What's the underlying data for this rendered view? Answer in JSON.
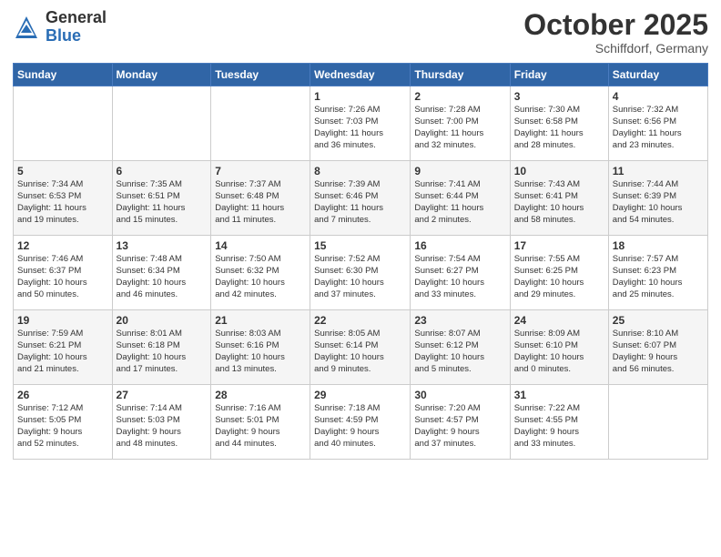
{
  "header": {
    "logo_general": "General",
    "logo_blue": "Blue",
    "month": "October 2025",
    "location": "Schiffdorf, Germany"
  },
  "days_of_week": [
    "Sunday",
    "Monday",
    "Tuesday",
    "Wednesday",
    "Thursday",
    "Friday",
    "Saturday"
  ],
  "weeks": [
    [
      {
        "day": "",
        "info": ""
      },
      {
        "day": "",
        "info": ""
      },
      {
        "day": "",
        "info": ""
      },
      {
        "day": "1",
        "info": "Sunrise: 7:26 AM\nSunset: 7:03 PM\nDaylight: 11 hours\nand 36 minutes."
      },
      {
        "day": "2",
        "info": "Sunrise: 7:28 AM\nSunset: 7:00 PM\nDaylight: 11 hours\nand 32 minutes."
      },
      {
        "day": "3",
        "info": "Sunrise: 7:30 AM\nSunset: 6:58 PM\nDaylight: 11 hours\nand 28 minutes."
      },
      {
        "day": "4",
        "info": "Sunrise: 7:32 AM\nSunset: 6:56 PM\nDaylight: 11 hours\nand 23 minutes."
      }
    ],
    [
      {
        "day": "5",
        "info": "Sunrise: 7:34 AM\nSunset: 6:53 PM\nDaylight: 11 hours\nand 19 minutes."
      },
      {
        "day": "6",
        "info": "Sunrise: 7:35 AM\nSunset: 6:51 PM\nDaylight: 11 hours\nand 15 minutes."
      },
      {
        "day": "7",
        "info": "Sunrise: 7:37 AM\nSunset: 6:48 PM\nDaylight: 11 hours\nand 11 minutes."
      },
      {
        "day": "8",
        "info": "Sunrise: 7:39 AM\nSunset: 6:46 PM\nDaylight: 11 hours\nand 7 minutes."
      },
      {
        "day": "9",
        "info": "Sunrise: 7:41 AM\nSunset: 6:44 PM\nDaylight: 11 hours\nand 2 minutes."
      },
      {
        "day": "10",
        "info": "Sunrise: 7:43 AM\nSunset: 6:41 PM\nDaylight: 10 hours\nand 58 minutes."
      },
      {
        "day": "11",
        "info": "Sunrise: 7:44 AM\nSunset: 6:39 PM\nDaylight: 10 hours\nand 54 minutes."
      }
    ],
    [
      {
        "day": "12",
        "info": "Sunrise: 7:46 AM\nSunset: 6:37 PM\nDaylight: 10 hours\nand 50 minutes."
      },
      {
        "day": "13",
        "info": "Sunrise: 7:48 AM\nSunset: 6:34 PM\nDaylight: 10 hours\nand 46 minutes."
      },
      {
        "day": "14",
        "info": "Sunrise: 7:50 AM\nSunset: 6:32 PM\nDaylight: 10 hours\nand 42 minutes."
      },
      {
        "day": "15",
        "info": "Sunrise: 7:52 AM\nSunset: 6:30 PM\nDaylight: 10 hours\nand 37 minutes."
      },
      {
        "day": "16",
        "info": "Sunrise: 7:54 AM\nSunset: 6:27 PM\nDaylight: 10 hours\nand 33 minutes."
      },
      {
        "day": "17",
        "info": "Sunrise: 7:55 AM\nSunset: 6:25 PM\nDaylight: 10 hours\nand 29 minutes."
      },
      {
        "day": "18",
        "info": "Sunrise: 7:57 AM\nSunset: 6:23 PM\nDaylight: 10 hours\nand 25 minutes."
      }
    ],
    [
      {
        "day": "19",
        "info": "Sunrise: 7:59 AM\nSunset: 6:21 PM\nDaylight: 10 hours\nand 21 minutes."
      },
      {
        "day": "20",
        "info": "Sunrise: 8:01 AM\nSunset: 6:18 PM\nDaylight: 10 hours\nand 17 minutes."
      },
      {
        "day": "21",
        "info": "Sunrise: 8:03 AM\nSunset: 6:16 PM\nDaylight: 10 hours\nand 13 minutes."
      },
      {
        "day": "22",
        "info": "Sunrise: 8:05 AM\nSunset: 6:14 PM\nDaylight: 10 hours\nand 9 minutes."
      },
      {
        "day": "23",
        "info": "Sunrise: 8:07 AM\nSunset: 6:12 PM\nDaylight: 10 hours\nand 5 minutes."
      },
      {
        "day": "24",
        "info": "Sunrise: 8:09 AM\nSunset: 6:10 PM\nDaylight: 10 hours\nand 0 minutes."
      },
      {
        "day": "25",
        "info": "Sunrise: 8:10 AM\nSunset: 6:07 PM\nDaylight: 9 hours\nand 56 minutes."
      }
    ],
    [
      {
        "day": "26",
        "info": "Sunrise: 7:12 AM\nSunset: 5:05 PM\nDaylight: 9 hours\nand 52 minutes."
      },
      {
        "day": "27",
        "info": "Sunrise: 7:14 AM\nSunset: 5:03 PM\nDaylight: 9 hours\nand 48 minutes."
      },
      {
        "day": "28",
        "info": "Sunrise: 7:16 AM\nSunset: 5:01 PM\nDaylight: 9 hours\nand 44 minutes."
      },
      {
        "day": "29",
        "info": "Sunrise: 7:18 AM\nSunset: 4:59 PM\nDaylight: 9 hours\nand 40 minutes."
      },
      {
        "day": "30",
        "info": "Sunrise: 7:20 AM\nSunset: 4:57 PM\nDaylight: 9 hours\nand 37 minutes."
      },
      {
        "day": "31",
        "info": "Sunrise: 7:22 AM\nSunset: 4:55 PM\nDaylight: 9 hours\nand 33 minutes."
      },
      {
        "day": "",
        "info": ""
      }
    ]
  ]
}
